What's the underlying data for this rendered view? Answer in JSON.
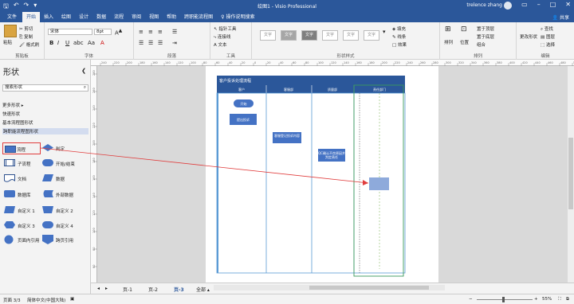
{
  "titlebar": {
    "title": "绘图1 - Visio Professional",
    "user": "trelence zhang"
  },
  "tabs": [
    {
      "label": "文件"
    },
    {
      "label": "开始"
    },
    {
      "label": "插入"
    },
    {
      "label": "绘图"
    },
    {
      "label": "设计"
    },
    {
      "label": "数据"
    },
    {
      "label": "流程"
    },
    {
      "label": "审阅"
    },
    {
      "label": "视图"
    },
    {
      "label": "帮助"
    },
    {
      "label": "跨职能流程图"
    },
    {
      "label": "操作说明搜索"
    }
  ],
  "share_label": "共享",
  "ribbon": {
    "clipboard": {
      "label": "剪贴板",
      "paste": "粘贴",
      "cut": "剪切",
      "copy": "复制",
      "painter": "格式刷"
    },
    "font": {
      "label": "字体",
      "family": "宋体",
      "size": "8pt"
    },
    "paragraph": {
      "label": "段落"
    },
    "tools": {
      "label": "工具",
      "pointer": "指针工具",
      "connector": "连接线",
      "text": "A 文本"
    },
    "shape_styles": {
      "label": "形状样式",
      "sample": "文字",
      "fill": "填充",
      "line": "线条",
      "effect": "效果"
    },
    "arrange": {
      "label": "排列",
      "align": "排列",
      "position": "位置",
      "front": "置于顶层",
      "back": "置于底层",
      "group": "组合"
    },
    "editing": {
      "label": "编辑",
      "change_shape": "更改形状",
      "find": "查找",
      "layer": "图层",
      "select": "选择"
    }
  },
  "shapes_panel": {
    "title": "形状",
    "search_placeholder": "搜索形状",
    "more_shapes": "更多形状",
    "stencils": [
      "快速形状",
      "基本流程图形状",
      "跨职能流程图形状"
    ],
    "selected_stencil": 2,
    "shapes": [
      {
        "label": "流程",
        "icon": "process-shape-icon"
      },
      {
        "label": "判定",
        "icon": "decision-shape-icon"
      },
      {
        "label": "子流程",
        "icon": "subprocess-shape-icon"
      },
      {
        "label": "开始/结束",
        "icon": "start-end-shape-icon"
      },
      {
        "label": "文档",
        "icon": "document-shape-icon"
      },
      {
        "label": "数据",
        "icon": "data-shape-icon"
      },
      {
        "label": "数据库",
        "icon": "database-shape-icon"
      },
      {
        "label": "外部数据",
        "icon": "external-data-shape-icon"
      },
      {
        "label": "自定义 1",
        "icon": "custom1-shape-icon"
      },
      {
        "label": "自定义 2",
        "icon": "custom2-shape-icon"
      },
      {
        "label": "自定义 3",
        "icon": "custom3-shape-icon"
      },
      {
        "label": "自定义 4",
        "icon": "custom4-shape-icon"
      },
      {
        "label": "页面内引用",
        "icon": "on-page-reference-shape-icon"
      },
      {
        "label": "跨页引用",
        "icon": "off-page-reference-shape-icon"
      }
    ]
  },
  "diagram": {
    "title": "客户投诉处理流程",
    "lanes": [
      "客户",
      "客服部",
      "质量部",
      "责任部门"
    ],
    "nodes": {
      "start": "开始",
      "submit": "提出投诉",
      "receive": "客服登记投诉内容",
      "check": "QC确认不良原因并判定责任"
    }
  },
  "ruler_labels": [
    "240",
    "220",
    "200",
    "180",
    "160",
    "140",
    "120",
    "100",
    "80",
    "60",
    "40",
    "20",
    "0",
    "20",
    "40",
    "60",
    "80",
    "100",
    "120",
    "140",
    "160",
    "180",
    "200",
    "220",
    "240",
    "260",
    "280",
    "300",
    "320",
    "340",
    "360",
    "380",
    "400",
    "420",
    "440",
    "460",
    "480",
    "500"
  ],
  "vruler_labels": [
    "280",
    "260",
    "240",
    "220",
    "200",
    "180",
    "160",
    "140",
    "120",
    "100",
    "80",
    "60"
  ],
  "page_tabs": {
    "pages": [
      "页-1",
      "页-2",
      "页-3"
    ],
    "active": 2,
    "all": "全部"
  },
  "status": {
    "page": "页面 3/3",
    "language": "简体中文(中国大陆)",
    "zoom": "55%"
  },
  "colors": {
    "accent": "#2b579a",
    "shape_fill": "#4472c4",
    "lane_border": "#5b9bd5",
    "selection": "#70ad47",
    "annotation": "#e03c3c"
  }
}
